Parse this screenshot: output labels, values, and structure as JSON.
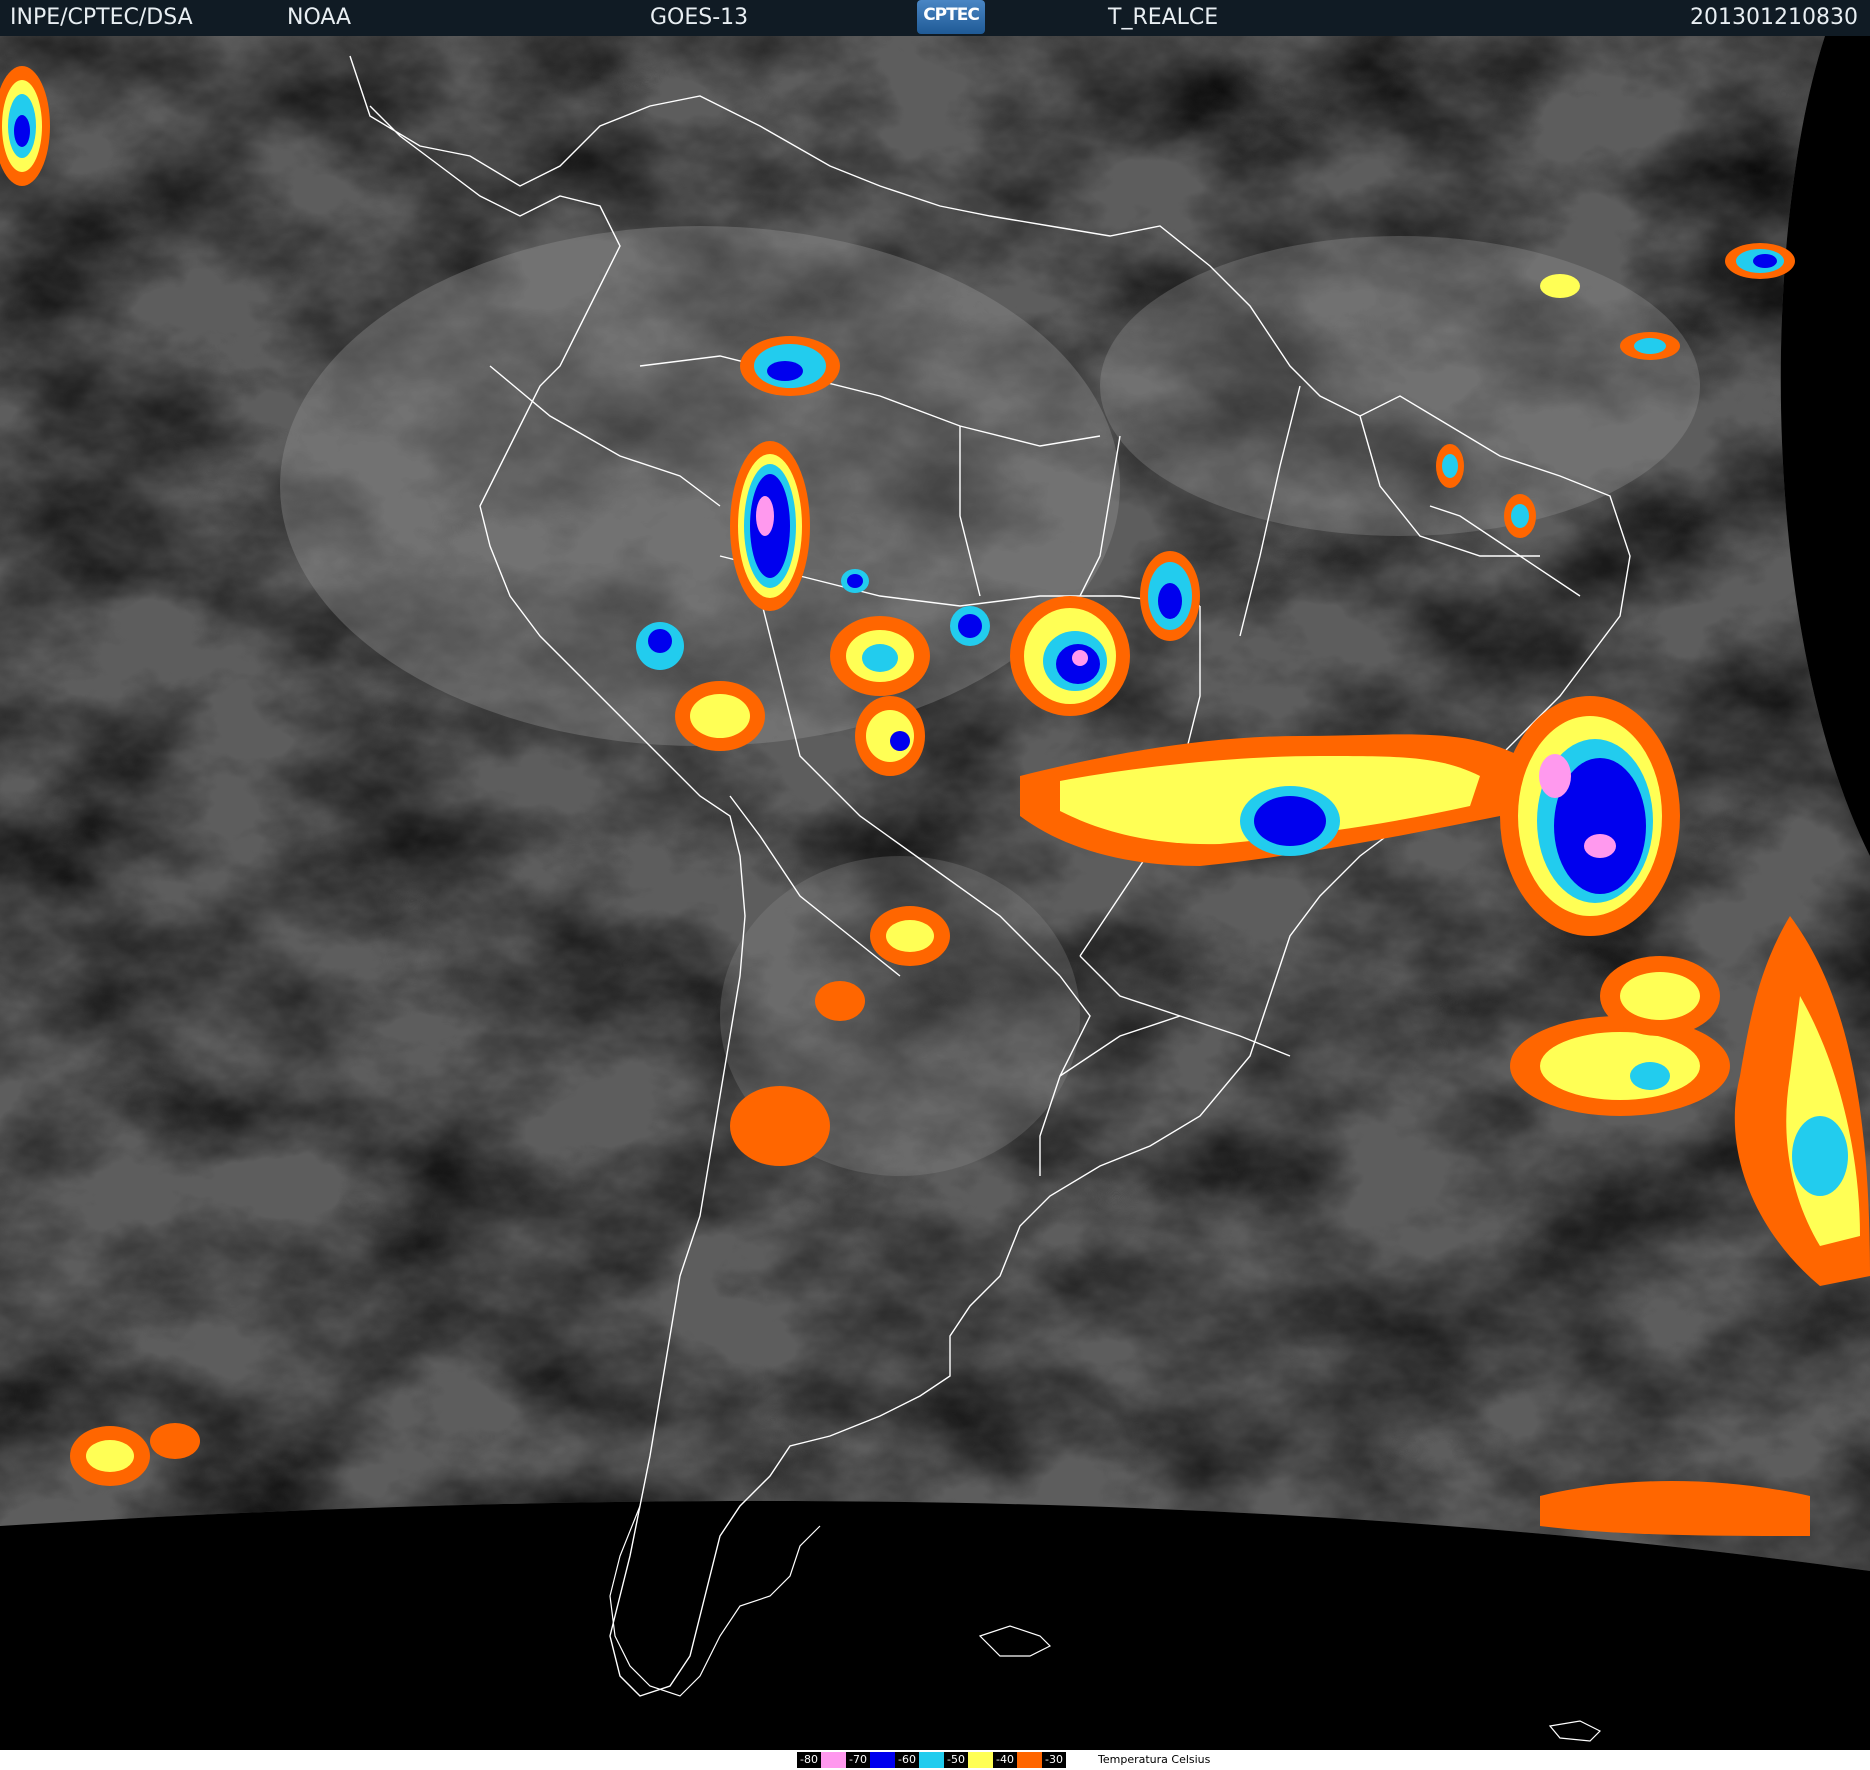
{
  "header": {
    "source": "INPE/CPTEC/DSA",
    "agency": "NOAA",
    "satellite": "GOES-13",
    "logo_text": "CPTEC",
    "product": "T_REALCE",
    "timestamp": "201301210830"
  },
  "legend": {
    "items": [
      {
        "label": "-80",
        "color": "#ff99ee"
      },
      {
        "label": "-70",
        "color": "#0000ee"
      },
      {
        "label": "-60",
        "color": "#22ccee"
      },
      {
        "label": "-50",
        "color": "#ffff55"
      },
      {
        "label": "-40",
        "color": "#ff6600"
      },
      {
        "label": "-30",
        "color": "#ff6600"
      }
    ],
    "title": "Temperatura   Celsius"
  },
  "colors": {
    "background": "#000000",
    "cloud_base": "#5f5f5f",
    "coast": "#ffffff"
  }
}
